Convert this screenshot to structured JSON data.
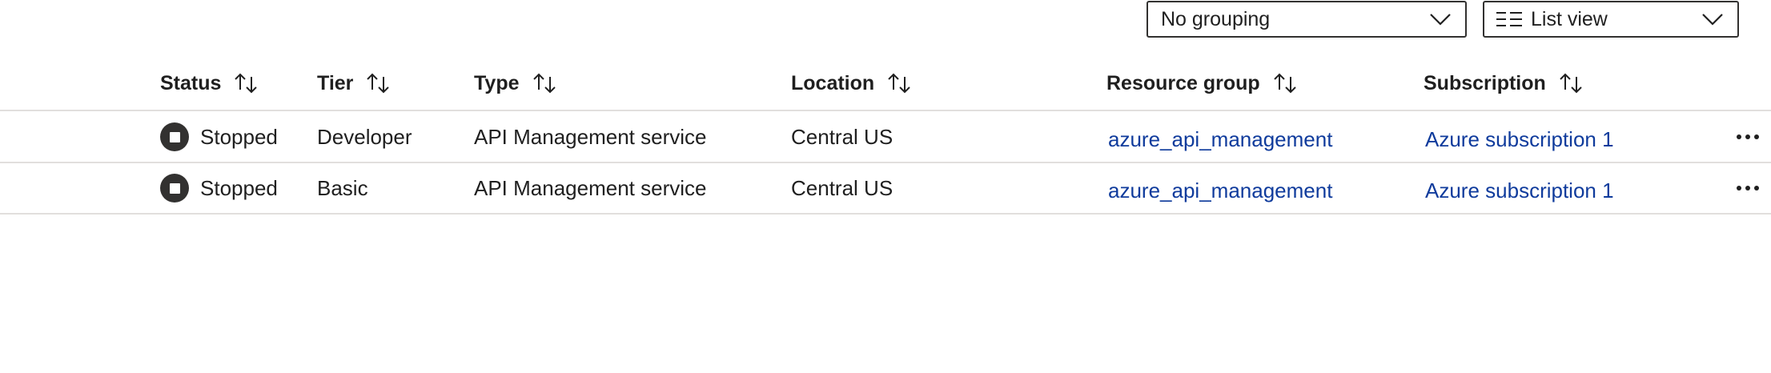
{
  "toolbar": {
    "grouping": {
      "value": "No grouping",
      "icon": "chevron-down-icon"
    },
    "view": {
      "value": "List view",
      "icon": "list-view-icon"
    }
  },
  "table": {
    "columns": [
      {
        "key": "status",
        "label": "Status",
        "sort_icon": "sort-icon"
      },
      {
        "key": "tier",
        "label": "Tier",
        "sort_icon": "sort-icon"
      },
      {
        "key": "type",
        "label": "Type",
        "sort_icon": "sort-icon"
      },
      {
        "key": "location",
        "label": "Location",
        "sort_icon": "sort-icon"
      },
      {
        "key": "resource_group",
        "label": "Resource group",
        "sort_icon": "sort-icon"
      },
      {
        "key": "subscription",
        "label": "Subscription",
        "sort_icon": "sort-icon"
      }
    ],
    "rows": [
      {
        "status": "Stopped",
        "status_icon": "stopped-icon",
        "tier": "Developer",
        "type": "API Management service",
        "location": "Central US",
        "resource_group": "azure_api_management",
        "subscription": "Azure subscription 1",
        "more_icon": "more-options-icon"
      },
      {
        "status": "Stopped",
        "status_icon": "stopped-icon",
        "tier": "Basic",
        "type": "API Management service",
        "location": "Central US",
        "resource_group": "azure_api_management",
        "subscription": "Azure subscription 1",
        "more_icon": "more-options-icon"
      }
    ]
  },
  "colors": {
    "link": "#0f3b9c",
    "text": "#1f1f1f",
    "divider": "#e1dfdd",
    "status_icon_bg": "#323130"
  }
}
